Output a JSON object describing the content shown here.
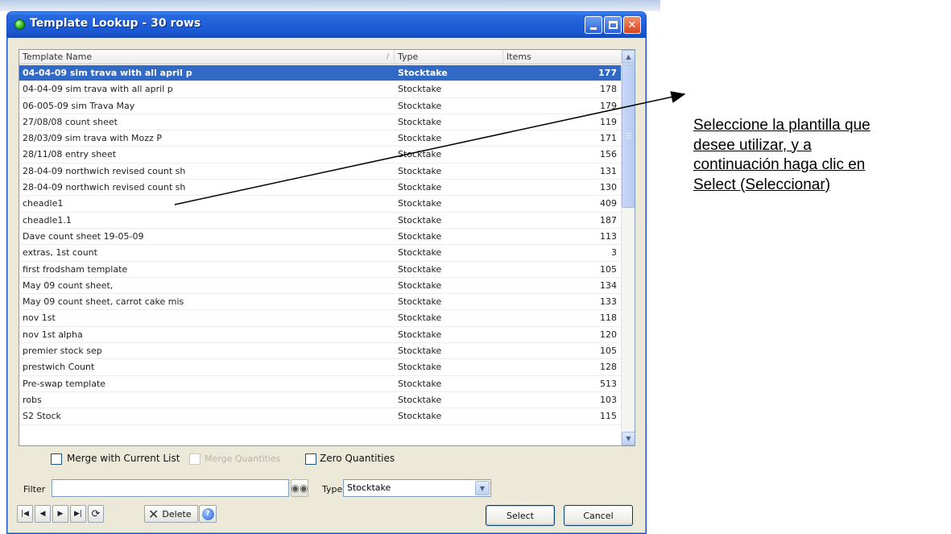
{
  "window": {
    "title": "Template Lookup - 30 rows",
    "buttons": {
      "minimize": "minimize",
      "maximize": "maximize",
      "close": "✕"
    }
  },
  "grid": {
    "columns": [
      "Template Name",
      "Type",
      "Items"
    ],
    "sort_indicator": "/",
    "rows": [
      {
        "name": "04-04-09 sim trava with all april p",
        "type": "Stocktake",
        "items": "177",
        "selected": true
      },
      {
        "name": "04-04-09 sim trava with all april p",
        "type": "Stocktake",
        "items": "178"
      },
      {
        "name": "06-005-09 sim Trava May",
        "type": "Stocktake",
        "items": "179"
      },
      {
        "name": "27/08/08 count sheet",
        "type": "Stocktake",
        "items": "119"
      },
      {
        "name": "28/03/09 sim trava with Mozz P",
        "type": "Stocktake",
        "items": "171"
      },
      {
        "name": "28/11/08 entry sheet",
        "type": "Stocktake",
        "items": "156"
      },
      {
        "name": "28-04-09 northwich revised count sh",
        "type": "Stocktake",
        "items": "131"
      },
      {
        "name": "28-04-09 northwich revised count sh",
        "type": "Stocktake",
        "items": "130"
      },
      {
        "name": "cheadle1",
        "type": "Stocktake",
        "items": "409"
      },
      {
        "name": "cheadle1.1",
        "type": "Stocktake",
        "items": "187"
      },
      {
        "name": "Dave count sheet 19-05-09",
        "type": "Stocktake",
        "items": "113"
      },
      {
        "name": "extras, 1st count",
        "type": "Stocktake",
        "items": "3"
      },
      {
        "name": "first frodsham template",
        "type": "Stocktake",
        "items": "105"
      },
      {
        "name": "May 09 count sheet,",
        "type": "Stocktake",
        "items": "134"
      },
      {
        "name": "May 09 count sheet, carrot cake mis",
        "type": "Stocktake",
        "items": "133"
      },
      {
        "name": "nov 1st",
        "type": "Stocktake",
        "items": "118"
      },
      {
        "name": "nov 1st alpha",
        "type": "Stocktake",
        "items": "120"
      },
      {
        "name": "premier stock sep",
        "type": "Stocktake",
        "items": "105"
      },
      {
        "name": "prestwich Count",
        "type": "Stocktake",
        "items": "128"
      },
      {
        "name": "Pre-swap template",
        "type": "Stocktake",
        "items": "513"
      },
      {
        "name": "robs",
        "type": "Stocktake",
        "items": "103"
      },
      {
        "name": "S2 Stock",
        "type": "Stocktake",
        "items": "115"
      }
    ]
  },
  "options": {
    "merge_current": "Merge with Current List",
    "merge_quantities": "Merge Quantities",
    "zero_quantities": "Zero Quantities"
  },
  "filter": {
    "label": "Filter",
    "value": "",
    "type_label": "Type",
    "type_value": "Stocktake"
  },
  "toolbar": {
    "delete_label": "Delete",
    "help": "?"
  },
  "actions": {
    "select": "Select",
    "cancel": "Cancel"
  },
  "annotation": {
    "lines": [
      "Seleccione la plantilla que",
      "desee utilizar, y a",
      "continuación haga clic en",
      "Select (Seleccionar)"
    ]
  },
  "colors": {
    "selection": "#3169c6",
    "titlebar": "#1f5fd9",
    "window_bg": "#ece9d8"
  }
}
